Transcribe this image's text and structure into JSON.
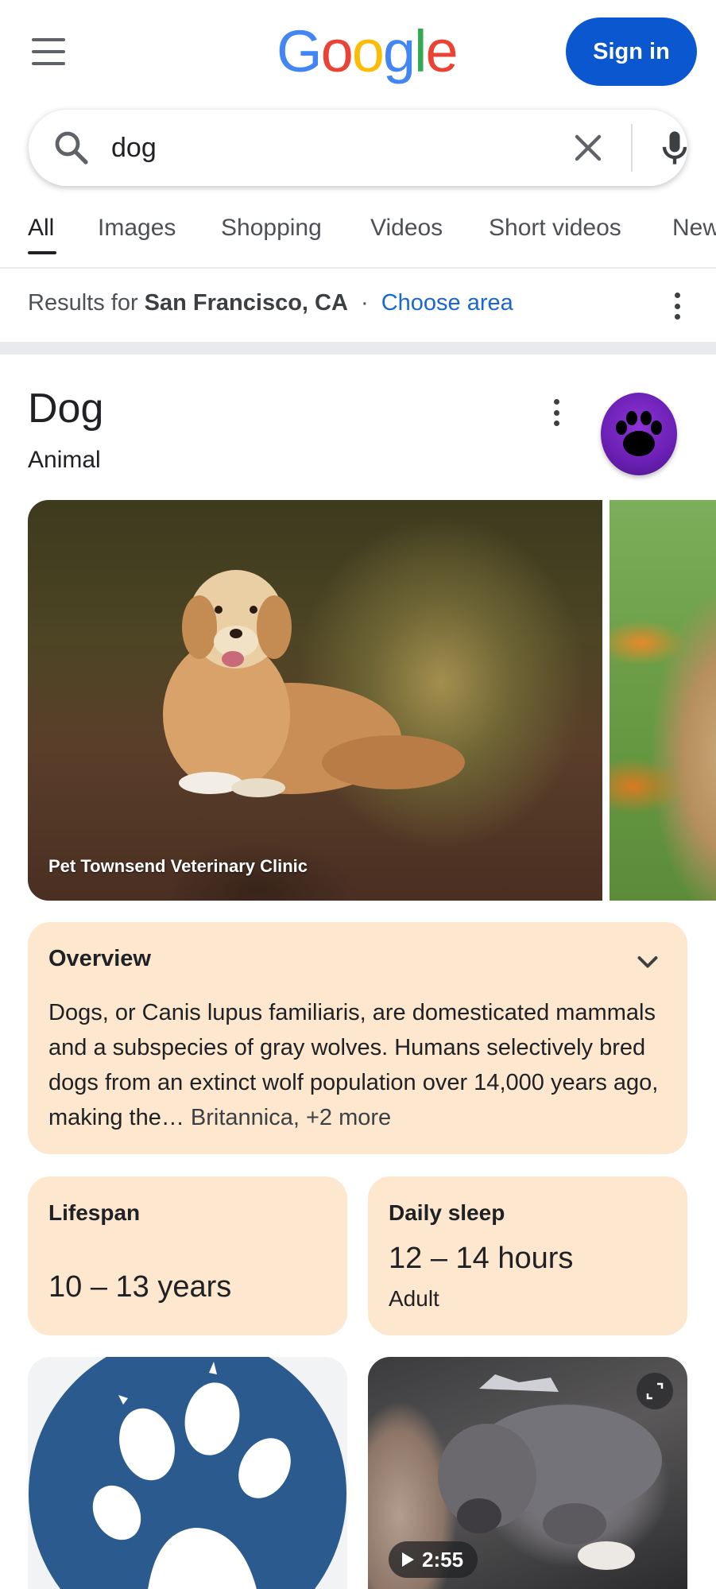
{
  "header": {
    "logo_letters": [
      "G",
      "o",
      "o",
      "g",
      "l",
      "e"
    ],
    "signin_label": "Sign in",
    "menu_icon": "hamburger-menu-icon"
  },
  "search": {
    "query": "dog",
    "icons": [
      "search-icon",
      "clear-icon",
      "mic-icon"
    ]
  },
  "tabs": [
    {
      "label": "All",
      "active": true
    },
    {
      "label": "Images"
    },
    {
      "label": "Shopping"
    },
    {
      "label": "Videos"
    },
    {
      "label": "Short videos"
    },
    {
      "label": "New"
    }
  ],
  "location": {
    "prefix": "Results for",
    "place": "San Francisco, CA",
    "separator": "·",
    "choose_label": "Choose area"
  },
  "knowledge_panel": {
    "title": "Dog",
    "subtitle": "Animal",
    "badge_icon": "paw-icon",
    "main_image_caption": "Pet Townsend Veterinary Clinic",
    "overview": {
      "title": "Overview",
      "text": "Dogs, or Canis lupus familiaris, are domesticated mammals and a subspecies of gray wolves. Humans selectively bred dogs from an extinct wolf population over 14,000 years ago, making the…",
      "source": " Britannica, +2 more"
    },
    "facts": [
      {
        "label": "Lifespan",
        "value": "10 – 13 years"
      },
      {
        "label": "Daily sleep",
        "value": "12 – 14 hours",
        "note": "Adult"
      }
    ],
    "video": {
      "duration": "2:55"
    }
  },
  "colors": {
    "brand_blue": "#0b57d0",
    "card_bg": "#fde7cf",
    "link_blue": "#1967d2",
    "badge_purple": "#6a1fb3"
  }
}
